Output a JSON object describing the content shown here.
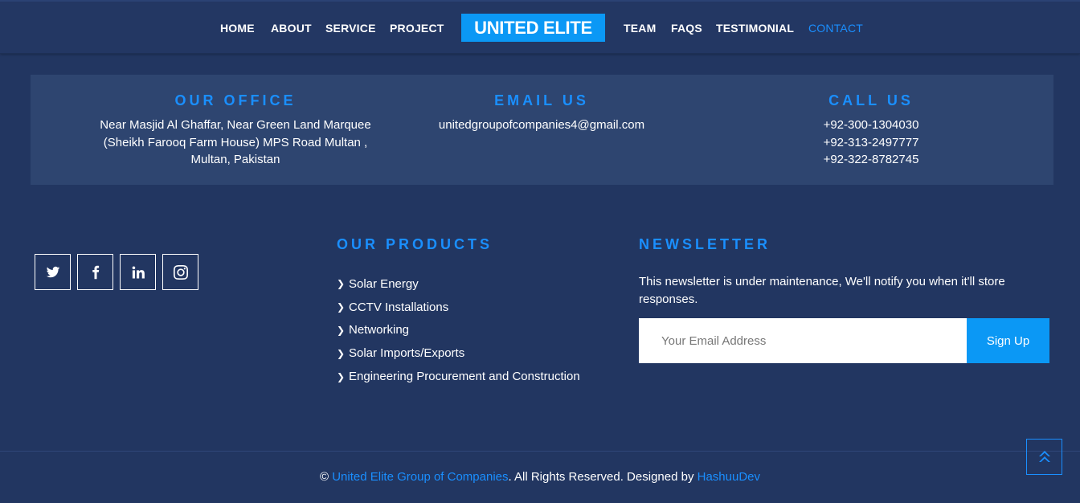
{
  "nav": {
    "left": [
      "HOME",
      "ABOUT",
      "SERVICE",
      "PROJECT"
    ],
    "brand": "UNITED ELITE",
    "right": [
      "TEAM",
      "FAQS",
      "TESTIMONIAL",
      "CONTACT"
    ],
    "active": "CONTACT"
  },
  "contact": {
    "office": {
      "title": "OUR OFFICE",
      "lines": [
        "Near Masjid Al Ghaffar, Near Green Land Marquee",
        "(Sheikh Farooq Farm House) MPS Road Multan ,",
        "Multan, Pakistan"
      ]
    },
    "email": {
      "title": "EMAIL US",
      "lines": [
        "unitedgroupofcompanies4@gmail.com"
      ]
    },
    "call": {
      "title": "CALL US",
      "lines": [
        "+92-300-1304030",
        "+92-313-2497777",
        "+92-322-8782745"
      ]
    }
  },
  "social": [
    "twitter-icon",
    "facebook-icon",
    "linkedin-icon",
    "instagram-icon"
  ],
  "products": {
    "title": "OUR PRODUCTS",
    "items": [
      "Solar Energy",
      "CCTV Installations",
      "Networking",
      "Solar Imports/Exports",
      "Engineering Procurement and Construction"
    ]
  },
  "newsletter": {
    "title": "NEWSLETTER",
    "desc": "This newsletter is under maintenance, We'll notify you when it'll store responses.",
    "placeholder": "Your Email Address",
    "button": "Sign Up"
  },
  "footer": {
    "copyright_symbol": "©",
    "company": "United Elite Group of Companies",
    "rights": ". All Rights Reserved. Designed by",
    "designer": "HashuuDev"
  },
  "colors": {
    "background": "#223661",
    "accent": "#1a8fff",
    "brand_bg": "#0b98f5",
    "panel": "#2e4570"
  }
}
